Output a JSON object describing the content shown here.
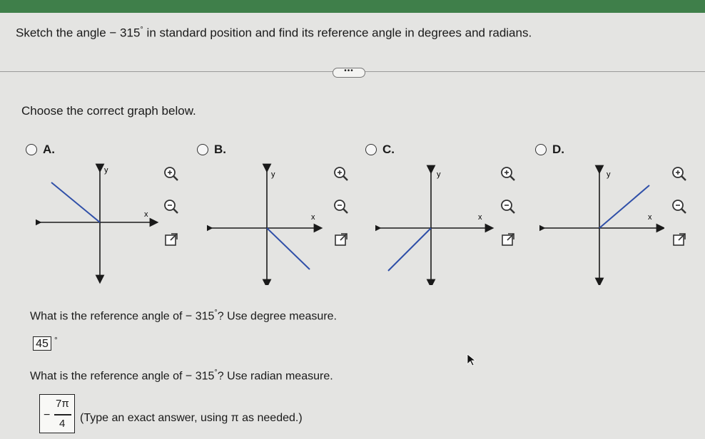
{
  "question": {
    "prefix": "Sketch the angle",
    "angle": "− 315",
    "degree": "°",
    "suffix": "in standard position and find its reference angle in degrees and radians."
  },
  "more_button": "•••",
  "prompt": "Choose the correct graph below.",
  "options": [
    {
      "label": "A."
    },
    {
      "label": "B."
    },
    {
      "label": "C."
    },
    {
      "label": "D."
    }
  ],
  "axis_labels": {
    "x": "x",
    "y": "y"
  },
  "tools": [
    "zoom-in-icon",
    "zoom-out-icon",
    "popout-icon"
  ],
  "degree_question": {
    "prefix": "What is the reference angle of",
    "angle": "− 315",
    "degree": "°",
    "suffix": "? Use degree measure."
  },
  "degree_answer": "45",
  "degree_unit": "°",
  "radian_question": {
    "prefix": "What is the reference angle of",
    "angle": "− 315",
    "degree": "°",
    "suffix": "? Use radian measure."
  },
  "radian_answer": {
    "sign": "−",
    "numerator": "7π",
    "denominator": "4"
  },
  "hint": "(Type an exact answer, using π as needed.)",
  "colors": {
    "ray": "#2f4fa8",
    "axis": "#1a1a1a",
    "header": "#3f7f4a"
  }
}
